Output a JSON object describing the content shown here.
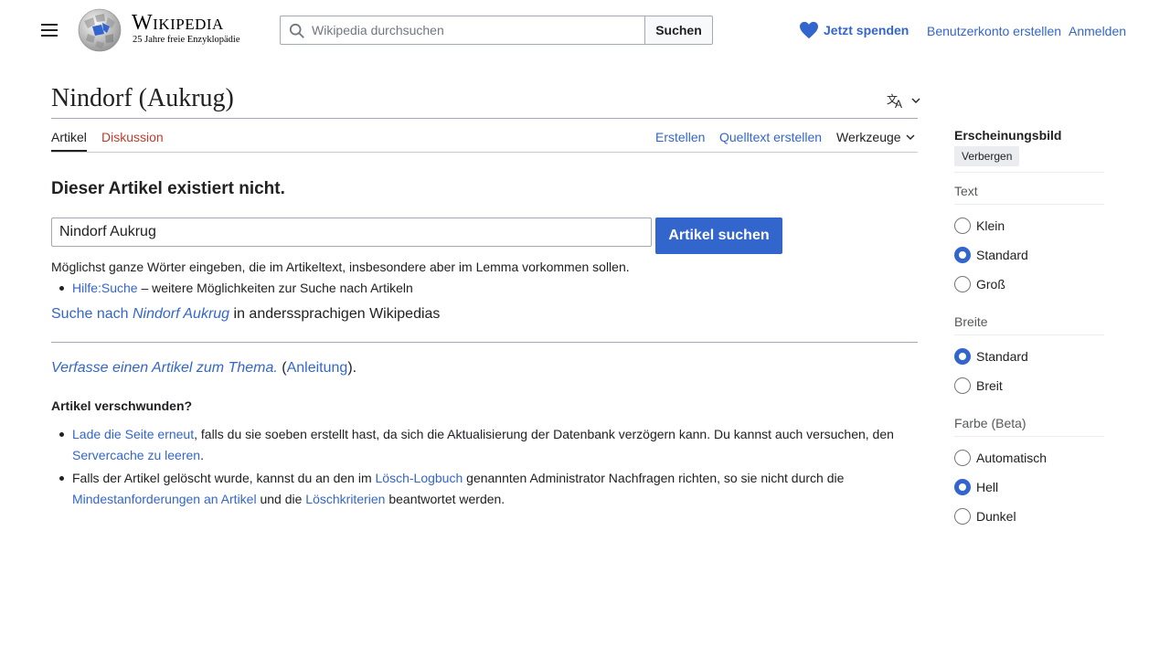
{
  "header": {
    "logo_wordmark": "Wikipedia",
    "logo_tagline": "25 Jahre freie Enzyklopädie",
    "search_placeholder": "Wikipedia durchsuchen",
    "search_button": "Suchen",
    "donate_label": "Jetzt spenden",
    "create_account": "Benutzerkonto erstellen",
    "login": "Anmelden"
  },
  "page": {
    "title": "Nindorf (Aukrug)",
    "tabs": {
      "article": "Artikel",
      "discussion": "Diskussion",
      "create": "Erstellen",
      "create_source": "Quelltext erstellen",
      "tools": "Werkzeuge"
    }
  },
  "content": {
    "notice_heading": "Dieser Artikel existiert nicht.",
    "search_value": "Nindorf Aukrug",
    "search_button": "Artikel suchen",
    "search_hint": "Möglichst ganze Wörter eingeben, die im Artikeltext, insbesondere aber im Lemma vorkommen sollen.",
    "help_link": "Hilfe:Suche",
    "help_text": " – weitere Möglichkeiten zur Suche nach Artikeln",
    "other_lang_link_prefix": "Suche nach ",
    "other_lang_link_term": "Nindorf Aukrug",
    "other_lang_text": " in anderssprachigen Wikipedias",
    "write_link": "Verfasse einen Artikel zum Thema.",
    "write_open": " (",
    "guide_link": "Anleitung",
    "write_close": ").",
    "missing_heading": "Artikel verschwunden?",
    "item1_link": "Lade die Seite erneut",
    "item1_text": ", falls du sie soeben erstellt hast, da sich die Aktualisierung der Datenbank verzögern kann. Du kannst auch versuchen, den",
    "item1_link2": "Servercache zu leeren",
    "item1_end": ".",
    "item2_text1": "Falls der Artikel gelöscht wurde, kannst du an den im ",
    "item2_link1": "Lösch-Logbuch",
    "item2_text2": " genannten Administrator Nachfragen richten, so sie nicht durch die",
    "item2_link2": "Mindestanforderungen an Artikel",
    "item2_text3": " und die ",
    "item2_link3": "Löschkriterien",
    "item2_text4": " beantwortet werden."
  },
  "appearance": {
    "heading": "Erscheinungsbild",
    "hide_button": "Verbergen",
    "text_label": "Text",
    "text_options": [
      "Klein",
      "Standard",
      "Groß"
    ],
    "text_selected": "Standard",
    "width_label": "Breite",
    "width_options": [
      "Standard",
      "Breit"
    ],
    "width_selected": "Standard",
    "color_label": "Farbe (Beta)",
    "color_options": [
      "Automatisch",
      "Hell",
      "Dunkel"
    ],
    "color_selected": "Hell"
  },
  "colors": {
    "link": "#3366cc",
    "link_red": "#bf3c2c",
    "accent": "#3366cc",
    "text": "#202122"
  }
}
